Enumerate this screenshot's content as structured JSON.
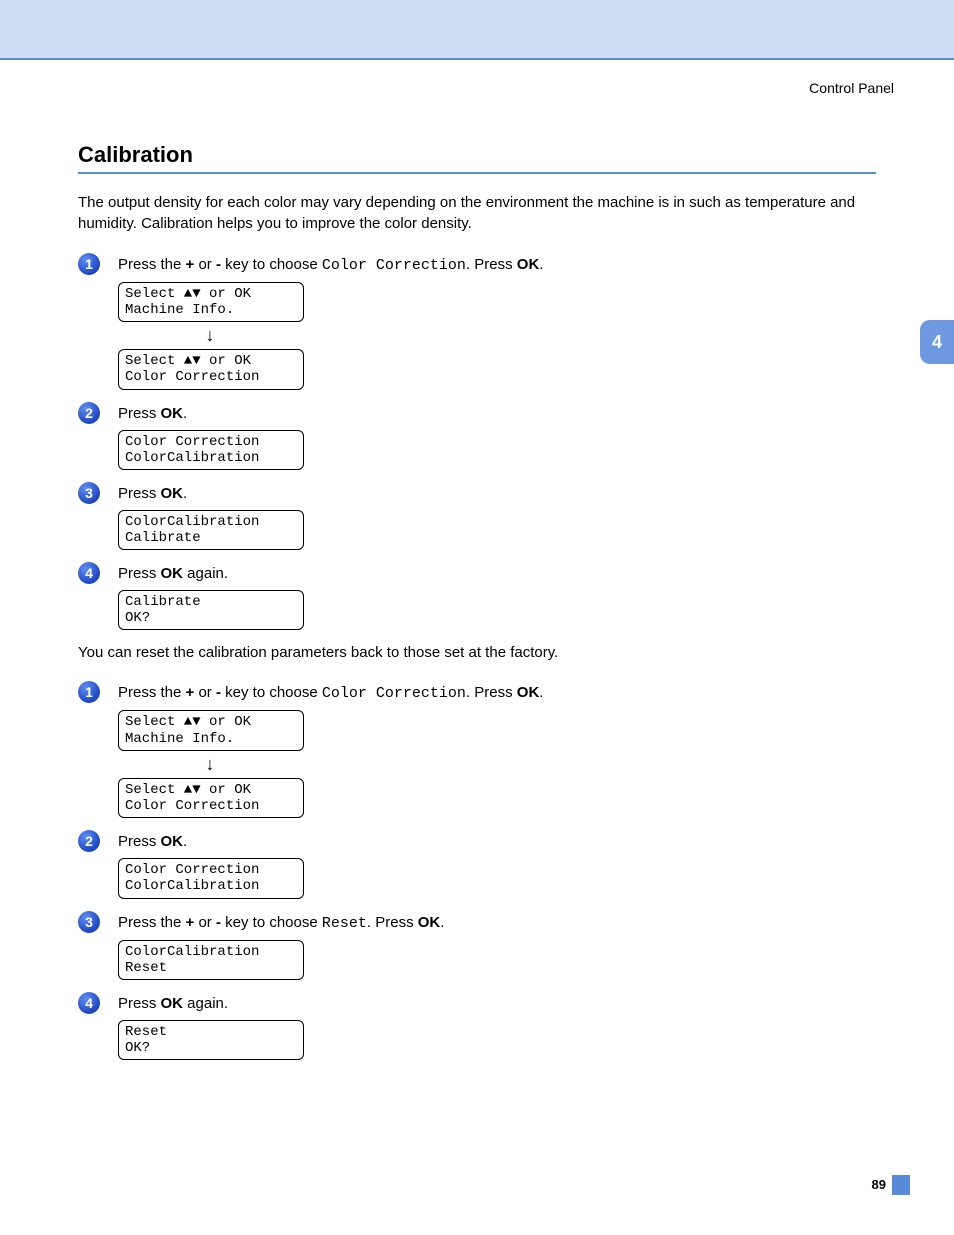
{
  "header_label": "Control Panel",
  "section_title": "Calibration",
  "intro": "The output density for each color may vary depending on the environment the machine is in such as temperature and humidity. Calibration helps you to improve the color density.",
  "mid": "You can reset the calibration parameters back to those set at the factory.",
  "side_tab": "4",
  "page_number": "89",
  "steps_a": [
    {
      "n": "1",
      "text_parts": [
        {
          "t": "Press the ",
          "b": false,
          "mono": false
        },
        {
          "t": "+",
          "b": true,
          "mono": false
        },
        {
          "t": " or ",
          "b": false,
          "mono": false
        },
        {
          "t": "-",
          "b": true,
          "mono": false
        },
        {
          "t": " key to choose ",
          "b": false,
          "mono": false
        },
        {
          "t": "Color Correction",
          "b": false,
          "mono": true
        },
        {
          "t": ". Press ",
          "b": false,
          "mono": false
        },
        {
          "t": "OK",
          "b": true,
          "mono": false
        },
        {
          "t": ".",
          "b": false,
          "mono": false
        }
      ],
      "lcds": [
        "Select ▲▼ or OK\nMachine Info.",
        "Select ▲▼ or OK\nColor Correction"
      ],
      "arrow_between": true
    },
    {
      "n": "2",
      "text_parts": [
        {
          "t": "Press ",
          "b": false,
          "mono": false
        },
        {
          "t": "OK",
          "b": true,
          "mono": false
        },
        {
          "t": ".",
          "b": false,
          "mono": false
        }
      ],
      "lcds": [
        "Color Correction\nColorCalibration"
      ],
      "arrow_between": false
    },
    {
      "n": "3",
      "text_parts": [
        {
          "t": "Press ",
          "b": false,
          "mono": false
        },
        {
          "t": "OK",
          "b": true,
          "mono": false
        },
        {
          "t": ".",
          "b": false,
          "mono": false
        }
      ],
      "lcds": [
        "ColorCalibration\nCalibrate"
      ],
      "arrow_between": false
    },
    {
      "n": "4",
      "text_parts": [
        {
          "t": "Press ",
          "b": false,
          "mono": false
        },
        {
          "t": "OK",
          "b": true,
          "mono": false
        },
        {
          "t": " again.",
          "b": false,
          "mono": false
        }
      ],
      "lcds": [
        "Calibrate\nOK?"
      ],
      "arrow_between": false
    }
  ],
  "steps_b": [
    {
      "n": "1",
      "text_parts": [
        {
          "t": "Press the ",
          "b": false,
          "mono": false
        },
        {
          "t": "+",
          "b": true,
          "mono": false
        },
        {
          "t": " or ",
          "b": false,
          "mono": false
        },
        {
          "t": "-",
          "b": true,
          "mono": false
        },
        {
          "t": " key to choose ",
          "b": false,
          "mono": false
        },
        {
          "t": "Color Correction",
          "b": false,
          "mono": true
        },
        {
          "t": ". Press ",
          "b": false,
          "mono": false
        },
        {
          "t": "OK",
          "b": true,
          "mono": false
        },
        {
          "t": ".",
          "b": false,
          "mono": false
        }
      ],
      "lcds": [
        "Select ▲▼ or OK\nMachine Info.",
        "Select ▲▼ or OK\nColor Correction"
      ],
      "arrow_between": true
    },
    {
      "n": "2",
      "text_parts": [
        {
          "t": "Press ",
          "b": false,
          "mono": false
        },
        {
          "t": "OK",
          "b": true,
          "mono": false
        },
        {
          "t": ".",
          "b": false,
          "mono": false
        }
      ],
      "lcds": [
        "Color Correction\nColorCalibration"
      ],
      "arrow_between": false
    },
    {
      "n": "3",
      "text_parts": [
        {
          "t": "Press the ",
          "b": false,
          "mono": false
        },
        {
          "t": "+",
          "b": true,
          "mono": false
        },
        {
          "t": " or ",
          "b": false,
          "mono": false
        },
        {
          "t": "-",
          "b": true,
          "mono": false
        },
        {
          "t": " key to choose ",
          "b": false,
          "mono": false
        },
        {
          "t": "Reset",
          "b": false,
          "mono": true
        },
        {
          "t": ". Press ",
          "b": false,
          "mono": false
        },
        {
          "t": "OK",
          "b": true,
          "mono": false
        },
        {
          "t": ".",
          "b": false,
          "mono": false
        }
      ],
      "lcds": [
        "ColorCalibration\nReset"
      ],
      "arrow_between": false
    },
    {
      "n": "4",
      "text_parts": [
        {
          "t": "Press ",
          "b": false,
          "mono": false
        },
        {
          "t": "OK",
          "b": true,
          "mono": false
        },
        {
          "t": " again.",
          "b": false,
          "mono": false
        }
      ],
      "lcds": [
        "Reset\nOK?"
      ],
      "arrow_between": false
    }
  ]
}
